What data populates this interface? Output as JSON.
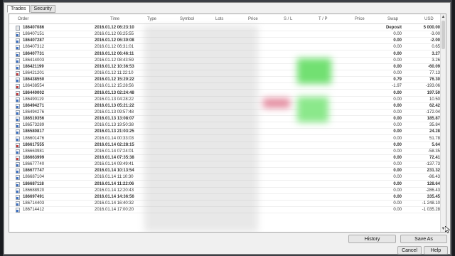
{
  "tabs": [
    {
      "label": "Trades",
      "active": true
    },
    {
      "label": "Security",
      "active": false
    }
  ],
  "columns": [
    "Order",
    "Time",
    "Type",
    "Symbol",
    "Lots",
    "Price",
    "S / L",
    "T / P",
    "Price",
    "Swap",
    "USD"
  ],
  "rows": [
    {
      "order": "186407086",
      "time": "2016.01.12 06:23:10",
      "swap": "Deposit",
      "usd": "5 000.00",
      "kind": "bal",
      "bold": true
    },
    {
      "order": "186407151",
      "time": "2016.01.12 06:25:55",
      "swap": "0.00",
      "usd": "-3.00",
      "kind": "buy"
    },
    {
      "order": "186407287",
      "time": "2016.01.12 06:30:08",
      "swap": "0.00",
      "usd": "-2.00",
      "kind": "buy",
      "bold": true
    },
    {
      "order": "186407312",
      "time": "2016.01.12 06:31:01",
      "swap": "0.00",
      "usd": "0.65",
      "kind": "buy"
    },
    {
      "order": "186407731",
      "time": "2016.01.12 06:46:11",
      "swap": "0.00",
      "usd": "3.27",
      "kind": "buy",
      "bold": true
    },
    {
      "order": "186414003",
      "time": "2016.01.12 08:43:59",
      "swap": "0.00",
      "usd": "3.26",
      "kind": "buy"
    },
    {
      "order": "186421199",
      "time": "2016.01.12 10:36:53",
      "swap": "0.00",
      "usd": "-60.09",
      "kind": "buy",
      "bold": true
    },
    {
      "order": "186421201",
      "time": "2016.01.12 11:22:10",
      "swap": "0.00",
      "usd": "77.13",
      "kind": "sell"
    },
    {
      "order": "186438550",
      "time": "2016.01.12 15:20:22",
      "swap": "0.79",
      "usd": "76.30",
      "kind": "buy",
      "bold": true
    },
    {
      "order": "186438554",
      "time": "2016.01.12 15:28:56",
      "swap": "-1.97",
      "usd": "-193.06",
      "kind": "sell"
    },
    {
      "order": "186440002",
      "time": "2016.01.13 02:24:48",
      "swap": "0.00",
      "usd": "197.50",
      "kind": "sell",
      "bold": true
    },
    {
      "order": "186490119",
      "time": "2016.01.13 04:28:22",
      "swap": "0.00",
      "usd": "10.50",
      "kind": "buy"
    },
    {
      "order": "186494271",
      "time": "2016.01.13 05:21:22",
      "swap": "0.00",
      "usd": "62.42",
      "kind": "buy",
      "bold": true
    },
    {
      "order": "186494276",
      "time": "2016.01.13 09:57:48",
      "swap": "0.00",
      "usd": "-172.04",
      "kind": "buy"
    },
    {
      "order": "186519356",
      "time": "2016.01.13 13:08:07",
      "swap": "0.00",
      "usd": "185.87",
      "kind": "buy",
      "bold": true
    },
    {
      "order": "186573289",
      "time": "2016.01.13 19:50:38",
      "swap": "0.00",
      "usd": "35.84",
      "kind": "buy"
    },
    {
      "order": "186580817",
      "time": "2016.01.13 21:03:25",
      "swap": "0.00",
      "usd": "24.28",
      "kind": "buy",
      "bold": true
    },
    {
      "order": "186601476",
      "time": "2016.01.14 00:33:03",
      "swap": "0.00",
      "usd": "51.78",
      "kind": "buy"
    },
    {
      "order": "186617555",
      "time": "2016.01.14 02:28:15",
      "swap": "0.00",
      "usd": "5.64",
      "kind": "sell",
      "bold": true
    },
    {
      "order": "186663981",
      "time": "2016.01.14 07:24:01",
      "swap": "0.00",
      "usd": "-58.35",
      "kind": "buy"
    },
    {
      "order": "186663999",
      "time": "2016.01.14 07:35:38",
      "swap": "0.00",
      "usd": "72.41",
      "kind": "sell",
      "bold": true
    },
    {
      "order": "186677740",
      "time": "2016.01.14 09:49:41",
      "swap": "0.00",
      "usd": "-137.73",
      "kind": "buy"
    },
    {
      "order": "186677747",
      "time": "2016.01.14 10:13:54",
      "swap": "0.00",
      "usd": "231.32",
      "kind": "buy",
      "bold": true
    },
    {
      "order": "186687104",
      "time": "2016.01.14 11:10:30",
      "swap": "0.00",
      "usd": "-86.43",
      "kind": "buy"
    },
    {
      "order": "186687118",
      "time": "2016.01.14 11:22:06",
      "swap": "0.00",
      "usd": "128.64",
      "kind": "buy",
      "bold": true
    },
    {
      "order": "186688920",
      "time": "2016.01.14 12:20:43",
      "swap": "0.00",
      "usd": "-286.43",
      "kind": "buy"
    },
    {
      "order": "186697491",
      "time": "2016.01.14 14:36:56",
      "swap": "0.00",
      "usd": "335.45",
      "kind": "buy",
      "bold": true
    },
    {
      "order": "186714403",
      "time": "2016.01.14 16:40:32",
      "swap": "0.00",
      "usd": "-1 248.10",
      "kind": "buy"
    },
    {
      "order": "186714412",
      "time": "2016.01.14 17:00:20",
      "swap": "0.00",
      "usd": "-1 035.28",
      "kind": "buy"
    }
  ],
  "buttons": {
    "history": "History",
    "save_as": "Save As",
    "cancel": "Cancel",
    "help": "Help"
  },
  "colors": {
    "tp_highlight": "#7fe07f",
    "sl_highlight": "#e89aaa",
    "buy_icon": "#3a6fc4",
    "sell_icon": "#c43a3a"
  }
}
